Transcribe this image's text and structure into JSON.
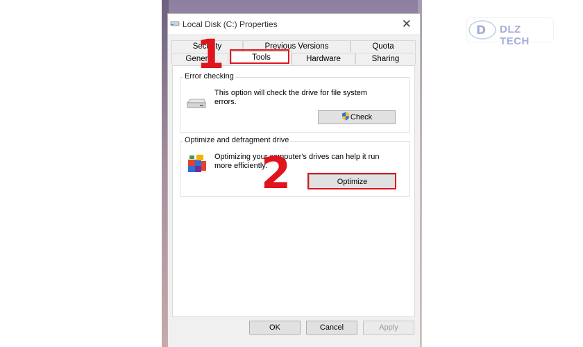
{
  "window": {
    "title": "Local Disk (C:) Properties",
    "close_glyph": "✕"
  },
  "tabs": {
    "row_back": [
      "Security",
      "Previous Versions",
      "Quota"
    ],
    "row_front": [
      "General",
      "Tools",
      "Hardware",
      "Sharing"
    ],
    "active": "Tools"
  },
  "error_checking": {
    "title": "Error checking",
    "description": "This option will check the drive for file system errors.",
    "button_label": "Check",
    "icon": "drive-icon"
  },
  "optimize": {
    "title": "Optimize and defragment drive",
    "description": "Optimizing your computer's drives can help it run more efficiently.",
    "button_label": "Optimize",
    "icon": "defrag-icon"
  },
  "footer": {
    "ok_label": "OK",
    "cancel_label": "Cancel",
    "apply_label": "Apply"
  },
  "annotations": {
    "step1": "1",
    "step2": "2",
    "color": "#e0141c"
  },
  "brand": {
    "text": "DLZ TECH"
  }
}
